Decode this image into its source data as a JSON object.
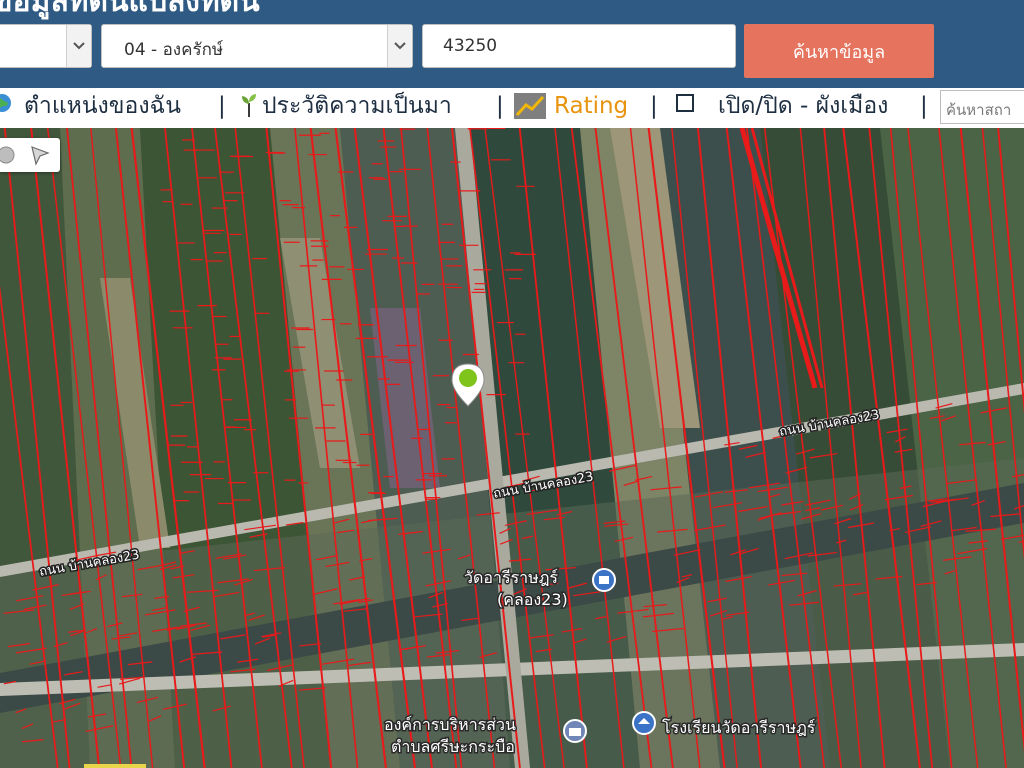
{
  "header": {
    "title": "ข้อมูลที่ดินแปลงที่ดิน",
    "selects": [
      {
        "value": ""
      },
      {
        "value": "04 - องครักษ์"
      }
    ],
    "postal_code": "43250",
    "search_label": "ค้นหาข้อมูล"
  },
  "toolbar": {
    "my_location": "ตำแหน่งของฉัน",
    "history": "ประวัติความเป็นมา",
    "rating": "Rating",
    "toggle_zoning": "เปิด/ปิด - ผังเมือง",
    "separator": "|",
    "place_search_placeholder": "ค้นหาสถา"
  },
  "map": {
    "parcel_color": "#e81a1a",
    "marker_color": "#7fc41b",
    "labels": {
      "road_1": "ถนน บ้านคลอง23",
      "road_2": "ถนน บ้านคลอง23",
      "road_3": "ถนน บ้านคลอง23",
      "temple_line1": "วัดอารีราษฎร์",
      "temple_line2": "(คลอง23)",
      "tao_line1": "องค์การบริหารส่วน",
      "tao_line2": "ตำบลศรีษะกระบือ",
      "school": "โรงเรียนวัดอารีราษฎร์"
    }
  },
  "icons": {
    "globe": "globe-icon",
    "sprout": "sprout-icon",
    "chart": "chart-icon",
    "checkbox": "checkbox-icon",
    "chevron": "chevron-down-icon",
    "marker": "map-pin-icon"
  }
}
